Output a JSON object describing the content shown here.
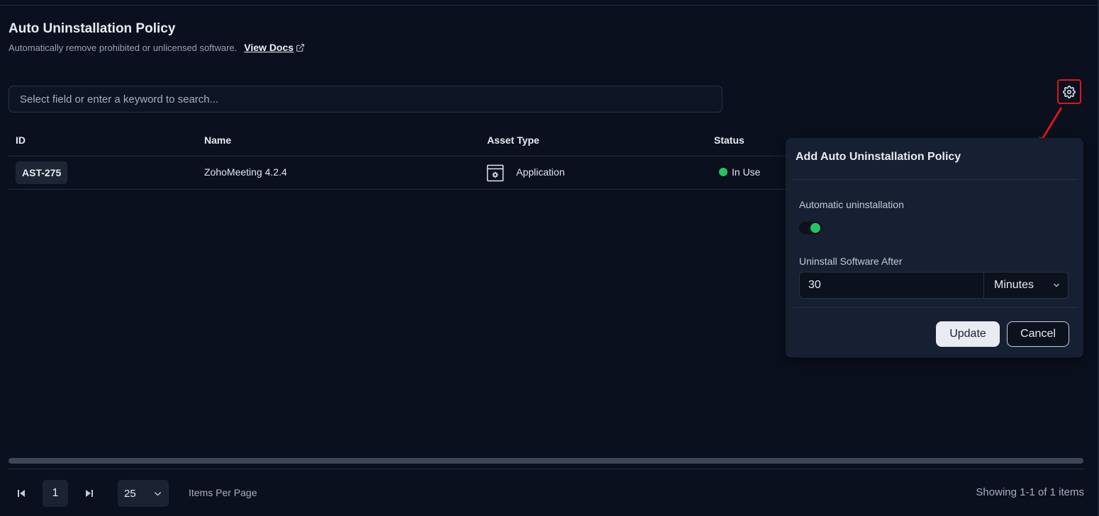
{
  "header": {
    "title": "Auto Uninstallation Policy",
    "subtitle": "Automatically remove prohibited or unlicensed software.",
    "docs_link": "View Docs"
  },
  "search": {
    "placeholder": "Select field or enter a keyword to search..."
  },
  "table": {
    "columns": [
      "ID",
      "Name",
      "Asset Type",
      "Status"
    ],
    "rows": [
      {
        "id": "AST-275",
        "name": "ZohoMeeting 4.2.4",
        "asset_type": "Application",
        "status": "In Use"
      }
    ]
  },
  "popover": {
    "title": "Add Auto Uninstallation Policy",
    "auto_label": "Automatic uninstallation",
    "auto_enabled": true,
    "after_label": "Uninstall Software After",
    "after_value": "30",
    "after_unit": "Minutes",
    "update_label": "Update",
    "cancel_label": "Cancel"
  },
  "pagination": {
    "current_page": "1",
    "per_page": "25",
    "per_page_label": "Items Per Page",
    "showing": "Showing 1-1 of 1 items"
  },
  "colors": {
    "background": "#0a101e",
    "accent_green": "#22c55e",
    "highlight_red": "#e0151b"
  }
}
